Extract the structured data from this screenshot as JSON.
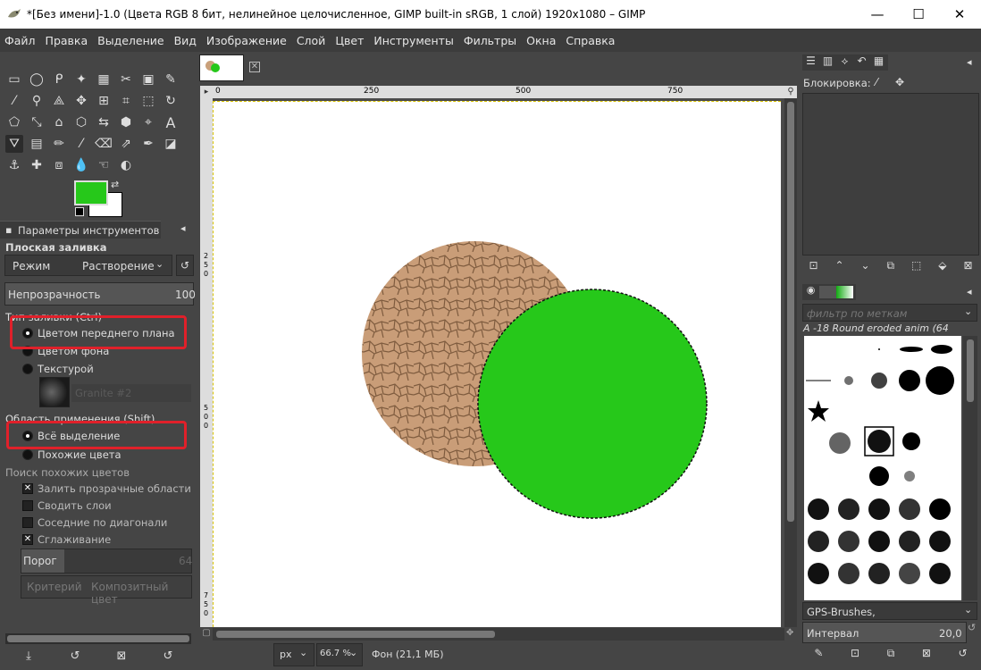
{
  "window": {
    "title": "*[Без имени]-1.0 (Цвета RGB 8 бит, нелинейное целочисленное, GIMP built-in sRGB, 1 слой) 1920x1080 – GIMP",
    "minimize": "—",
    "maximize": "☐",
    "close": "✕"
  },
  "menu": [
    "Файл",
    "Правка",
    "Выделение",
    "Вид",
    "Изображение",
    "Слой",
    "Цвет",
    "Инструменты",
    "Фильтры",
    "Окна",
    "Справка"
  ],
  "colors": {
    "foreground": "#26c81a",
    "background": "#ffffff",
    "highlight_box": "#e0202a"
  },
  "tool_options": {
    "tab_label": "Параметры инструментов",
    "tool_name": "Плоская заливка",
    "mode_label": "Режим",
    "mode_value": "Растворение",
    "opacity_label": "Непрозрачность",
    "opacity_value": "100",
    "fill_type_label": "Тип заливки (Ctrl)",
    "fill_fg": "Цветом переднего плана",
    "fill_bg": "Цветом фона",
    "fill_pattern": "Текстурой",
    "pattern_name": "Granite #2",
    "area_label": "Область применения (Shift)",
    "area_whole": "Всё выделение",
    "area_similar": "Похожие цвета",
    "similar_label": "Поиск похожих цветов",
    "fill_transparent": "Залить прозрачные области",
    "merge_layers": "Сводить слои",
    "diagonal": "Соседние по диагонали",
    "antialias": "Сглаживание",
    "threshold_label": "Порог",
    "threshold_value": "64",
    "criterion_label": "Критерий",
    "criterion_value": "Композитный цвет"
  },
  "ruler": {
    "h": [
      "0",
      "250",
      "500",
      "750"
    ],
    "v": [
      "2",
      "5",
      "0",
      "5",
      "0",
      "0",
      "7",
      "5",
      "0"
    ]
  },
  "status": {
    "unit": "px",
    "zoom": "66.7 %",
    "layer_info": "Фон (21,1 МБ)"
  },
  "layers": {
    "lock_label": "Блокировка:"
  },
  "brushes": {
    "filter_placeholder": "фильтр по меткам",
    "current_brush": "A -18 Round eroded anim (64",
    "brush_set": "GPS-Brushes,",
    "spacing_label": "Интервал",
    "spacing_value": "20,0"
  }
}
